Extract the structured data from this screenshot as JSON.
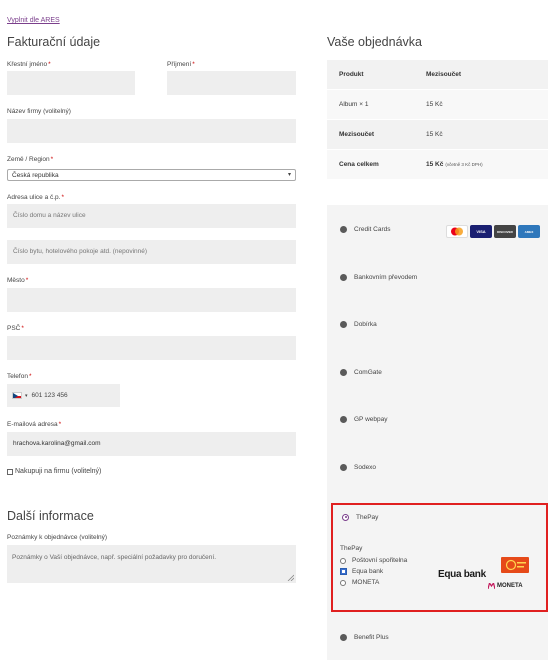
{
  "top_link": "Vyplnit dle ARES",
  "billing": {
    "title": "Fakturační údaje",
    "first_name_label": "Křestní jméno",
    "last_name_label": "Příjmení",
    "company_label": "Název firmy (volitelný)",
    "country_label": "Země / Region",
    "country_value": "Česká republika",
    "address_label": "Adresa ulice a č.p.",
    "address1_placeholder": "Číslo domu a název ulice",
    "address2_placeholder": "Číslo bytu, hotelového pokoje atd. (nepovinné)",
    "city_label": "Město",
    "zip_label": "PSČ",
    "phone_label": "Telefon",
    "phone_value": "601 123 456",
    "email_label": "E-mailová adresa",
    "email_value": "hrachova.karolina@gmail.com",
    "company_checkbox": "Nakupuji na firmu (volitelný)",
    "required_mark": "*"
  },
  "extra": {
    "title": "Další informace",
    "notes_label": "Poznámky k objednávce (volitelný)",
    "notes_placeholder": "Poznámky o Vaší objednávce, např. speciální požadavky pro doručení."
  },
  "order": {
    "title": "Vaše objednávka",
    "col_product": "Produkt",
    "col_subtotal": "Mezisoučet",
    "item_name": "Album",
    "item_qty": "× 1",
    "item_price": "15 Kč",
    "subtotal_label": "Mezisoučet",
    "subtotal_value": "15 Kč",
    "total_label": "Cena celkem",
    "total_value": "15 Kč",
    "total_vat_note": "(včetně 3 Kč DPH)"
  },
  "payment": {
    "methods": [
      {
        "label": "Credit Cards"
      },
      {
        "label": "Bankovním převodem"
      },
      {
        "label": "Dobírka"
      },
      {
        "label": "ComGate"
      },
      {
        "label": "GP webpay"
      },
      {
        "label": "Sodexo"
      },
      {
        "label": "ThePay"
      },
      {
        "label": "Benefit Plus"
      }
    ],
    "card_logos": [
      "MC",
      "VISA",
      "DISCOVER",
      "AMEX"
    ],
    "thepay": {
      "heading": "ThePay",
      "options": [
        "Poštovní spořitelna",
        "Equa bank",
        "MONETA"
      ],
      "selected": "Equa bank",
      "logo_equa": "Equa bank",
      "logo_moneta": "MONETA"
    }
  },
  "colors": {
    "accent": "#7b3f8c",
    "highlight_border": "#e02020",
    "input_bg": "#eeeeee"
  }
}
